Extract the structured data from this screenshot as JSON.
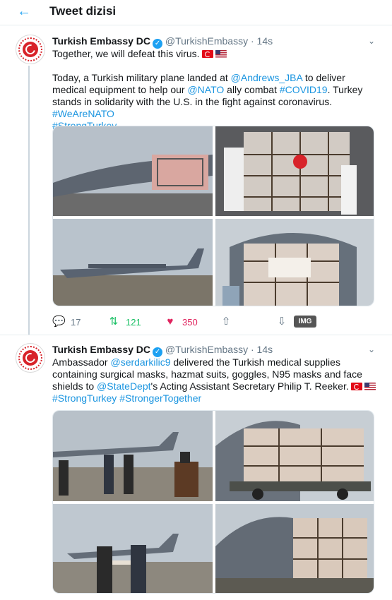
{
  "header": {
    "back_icon": "arrow-left-icon",
    "title": "Tweet dizisi"
  },
  "tweets": [
    {
      "name": "Turkish Embassy DC",
      "handle": "@TurkishEmbassy",
      "dot": "·",
      "time": "14s",
      "line1": "Together, we will defeat this virus.",
      "p2_a": "Today, a Turkish military plane landed at ",
      "p2_mention1": "@Andrews_JBA",
      "p2_b": " to deliver medical equipment to help our ",
      "p2_mention2": "@NATO",
      "p2_c": " ally combat ",
      "p2_tag1": "#COVID19",
      "p2_d": ". Turkey stands in solidarity with the U.S. in the fight against coronavirus. ",
      "p2_tag2": "#WeAreNATO",
      "p2_tag3": "#StrongTurkey",
      "reply_count": "17",
      "retweet_count": "121",
      "like_count": "350",
      "img_badge": "IMG"
    },
    {
      "name": "Turkish Embassy DC",
      "handle": "@TurkishEmbassy",
      "dot": "·",
      "time": "14s",
      "t_a": "Ambassador ",
      "t_mention1": "@serdarkilic9",
      "t_b": " delivered the Turkish medical supplies containing surgical masks, hazmat suits, goggles, N95 masks and face shields to ",
      "t_mention2": "@StateDept",
      "t_c": "'s Acting Assistant Secretary Philip T. Reeker.",
      "t_tag1": "#StrongTurkey",
      "t_tag2": "#StrongerTogether"
    }
  ],
  "colors": {
    "accent": "#1da1f2",
    "link": "#1b95e0",
    "retweet": "#17bf63",
    "like": "#e0245e",
    "muted": "#657786"
  }
}
